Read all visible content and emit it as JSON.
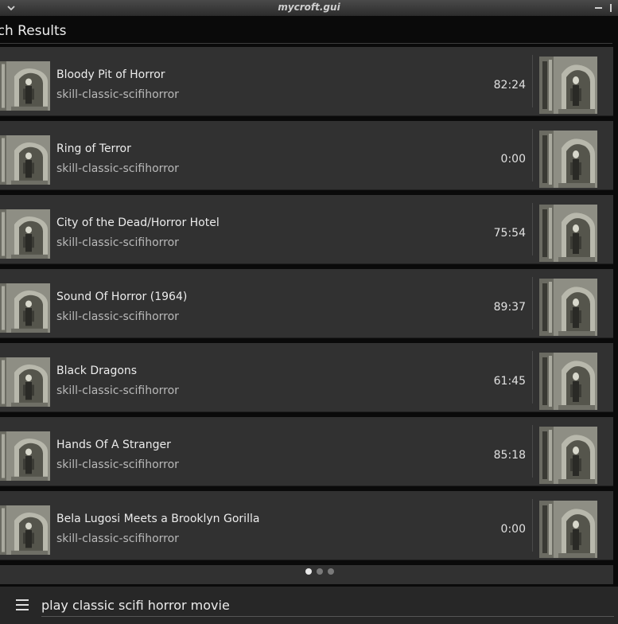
{
  "window": {
    "title": "mycroft.gui",
    "menu_icon": "chevron-down-icon",
    "minimize_icon": "minimize-icon",
    "close_icon": "close-icon"
  },
  "header": {
    "title": "rch Results"
  },
  "results": [
    {
      "title": "Bloody Pit of Horror",
      "skill": "skill-classic-scifihorror",
      "duration": "82:24"
    },
    {
      "title": "Ring of Terror",
      "skill": "skill-classic-scifihorror",
      "duration": "0:00"
    },
    {
      "title": "City of the Dead/Horror Hotel",
      "skill": "skill-classic-scifihorror",
      "duration": "75:54"
    },
    {
      "title": "Sound Of Horror (1964)",
      "skill": "skill-classic-scifihorror",
      "duration": "89:37"
    },
    {
      "title": "Black Dragons",
      "skill": "skill-classic-scifihorror",
      "duration": "61:45"
    },
    {
      "title": "Hands Of A Stranger",
      "skill": "skill-classic-scifihorror",
      "duration": "85:18"
    },
    {
      "title": "Bela Lugosi Meets a Brooklyn Gorilla",
      "skill": "skill-classic-scifihorror",
      "duration": "0:00"
    }
  ],
  "pagination": {
    "pages": 3,
    "current": 1
  },
  "bottom_bar": {
    "menu_icon": "hamburger-menu-icon",
    "query": "play classic scifi horror movie"
  },
  "colors": {
    "card_bg": "#313131",
    "window_bg": "#0a0a0a",
    "input_bar_bg": "#272727"
  }
}
